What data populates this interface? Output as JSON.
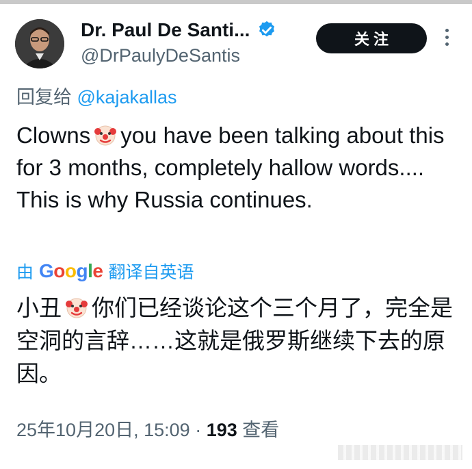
{
  "author": {
    "display_name": "Dr. Paul De Santi...",
    "handle": "@DrPaulyDeSantis",
    "verified_icon": "verified-badge-icon"
  },
  "follow_button": {
    "label": "关注"
  },
  "reply": {
    "prefix": "回复给",
    "mention": "@kajakallas"
  },
  "tweet": {
    "text_before_emoji": "Clowns",
    "text_after_emoji": "you have been talking about this for 3 months, completely hallow words.... This is why Russia continues."
  },
  "translation": {
    "prefix": "由",
    "provider": "Google",
    "suffix": "翻译自英语",
    "text_before_emoji": "小丑",
    "text_after_emoji": "你们已经谈论这个三个月了，完全是空洞的言辞……这就是俄罗斯继续下去的原因。"
  },
  "meta": {
    "timestamp": "25年10月20日, 15:09",
    "separator": "·",
    "views_count": "193",
    "views_label": "查看"
  },
  "colors": {
    "accent": "#1d9bf0",
    "text": "#0f1419",
    "muted": "#536471",
    "button_bg": "#0f1419"
  }
}
